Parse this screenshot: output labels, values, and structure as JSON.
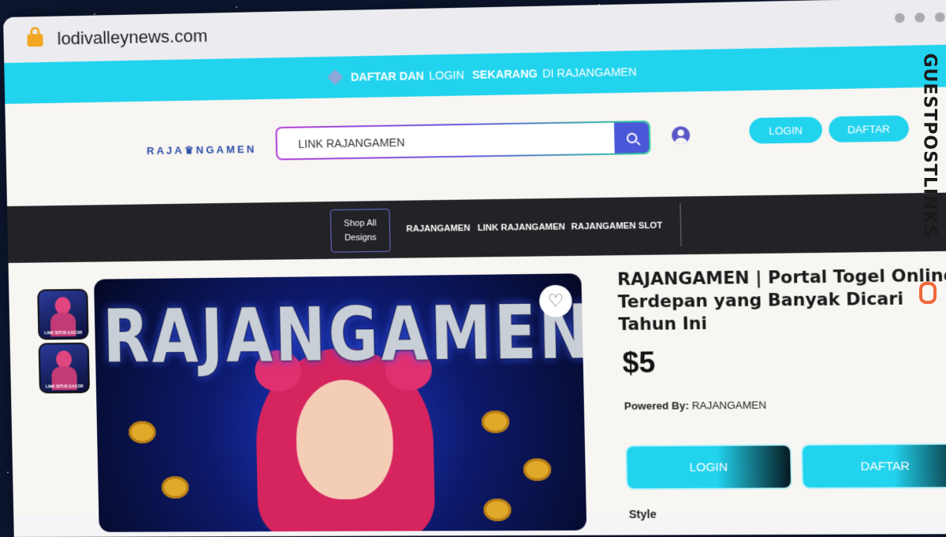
{
  "browser": {
    "url": "lodivalleynews.com"
  },
  "promo_bar": {
    "bold1": "DAFTAR DAN",
    "normal1": "LOGIN",
    "bold2": "SEKARANG",
    "normal2": "DI RAJANGAMEN"
  },
  "header": {
    "logo": "RAJA♛NGAMEN",
    "search_value": "LINK RAJANGAMEN",
    "login_label": "LOGIN",
    "daftar_label": "DAFTAR"
  },
  "nav": {
    "shop_all": "Shop All Designs",
    "items": [
      "RAJANGAMEN",
      "LINK RAJANGAMEN",
      "RAJANGAMEN SLOT"
    ]
  },
  "gallery": {
    "hero_text": "RAJANGAMEN",
    "thumb_caption": "LINK SITUS GACOR"
  },
  "product": {
    "title": "RAJANGAMEN | Portal Togel Online Terdepan yang Banyak Dicari Tahun Ini",
    "price": "$5",
    "powered_label": "Powered By:",
    "powered_value": "RAJANGAMEN",
    "login_button": "LOGIN",
    "daftar_button": "DAFTAR",
    "style_label": "Style"
  },
  "watermark": {
    "text": "GUESTPOSTLINKS"
  },
  "colors": {
    "accent": "#22d3ee",
    "nav_bg": "#232327",
    "search_button": "#4b57d9"
  }
}
